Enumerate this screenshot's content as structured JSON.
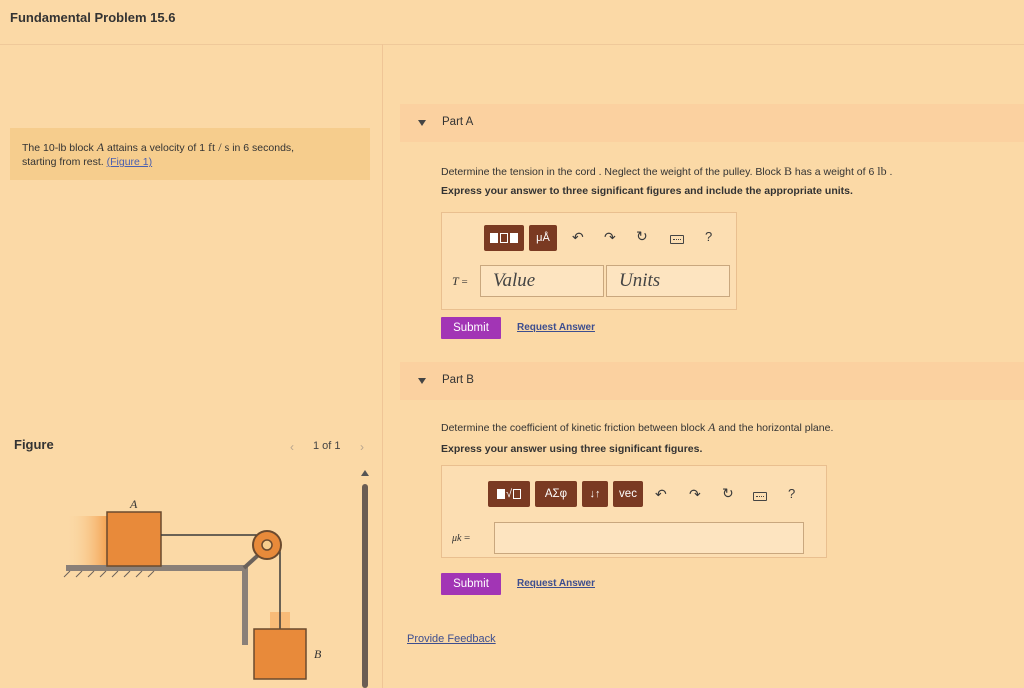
{
  "header": {
    "title": "Fundamental Problem 15.6"
  },
  "problem": {
    "text_before_block": "The 10-lb block ",
    "block_symbol": "A",
    "text_after_block": " attains a velocity of 1 ",
    "unit": "ft / s",
    "text_after_unit": " in 6 seconds,",
    "line2": "starting from rest. ",
    "figure_link": "(Figure 1)"
  },
  "figure": {
    "label": "Figure",
    "pager": "1 of 1",
    "prev_glyph": "‹",
    "next_glyph": "›",
    "block_a_label": "A",
    "block_b_label": "B"
  },
  "part_a": {
    "label": "Part A",
    "question_prefix": "Determine the tension in the cord . Neglect the weight of the pulley. Block ",
    "question_block": "B",
    "question_middle": " has a weight of 6 ",
    "question_unit": "lb",
    "question_suffix": " .",
    "instruction": "Express your answer to three significant figures and include the appropriate units.",
    "variable": "T",
    "equals": "=",
    "value_placeholder": "Value",
    "units_placeholder": "Units",
    "submit_label": "Submit",
    "request_label": "Request Answer",
    "help_glyph": "?"
  },
  "part_b": {
    "label": "Part B",
    "question_prefix": "Determine the coefficient of kinetic friction between block ",
    "question_block": "A",
    "question_suffix": " and the horizontal plane.",
    "instruction": "Express your answer using three significant figures.",
    "variable": "μk",
    "equals": "=",
    "tool_greek": "ΑΣφ",
    "tool_arrows": "↓↑",
    "tool_vec": "vec",
    "submit_label": "Submit",
    "request_label": "Request Answer",
    "help_glyph": "?"
  },
  "footer": {
    "feedback_label": "Provide Feedback"
  },
  "colors": {
    "background": "#fbd9a6",
    "submit": "#a235b5",
    "toolbar_button": "#7a3a22",
    "link": "#3d4e8f",
    "block_orange": "#e88a3a"
  },
  "icons": [
    "undo-icon",
    "redo-icon",
    "reset-icon",
    "keyboard-icon",
    "help-icon",
    "collapse-triangle-icon"
  ]
}
